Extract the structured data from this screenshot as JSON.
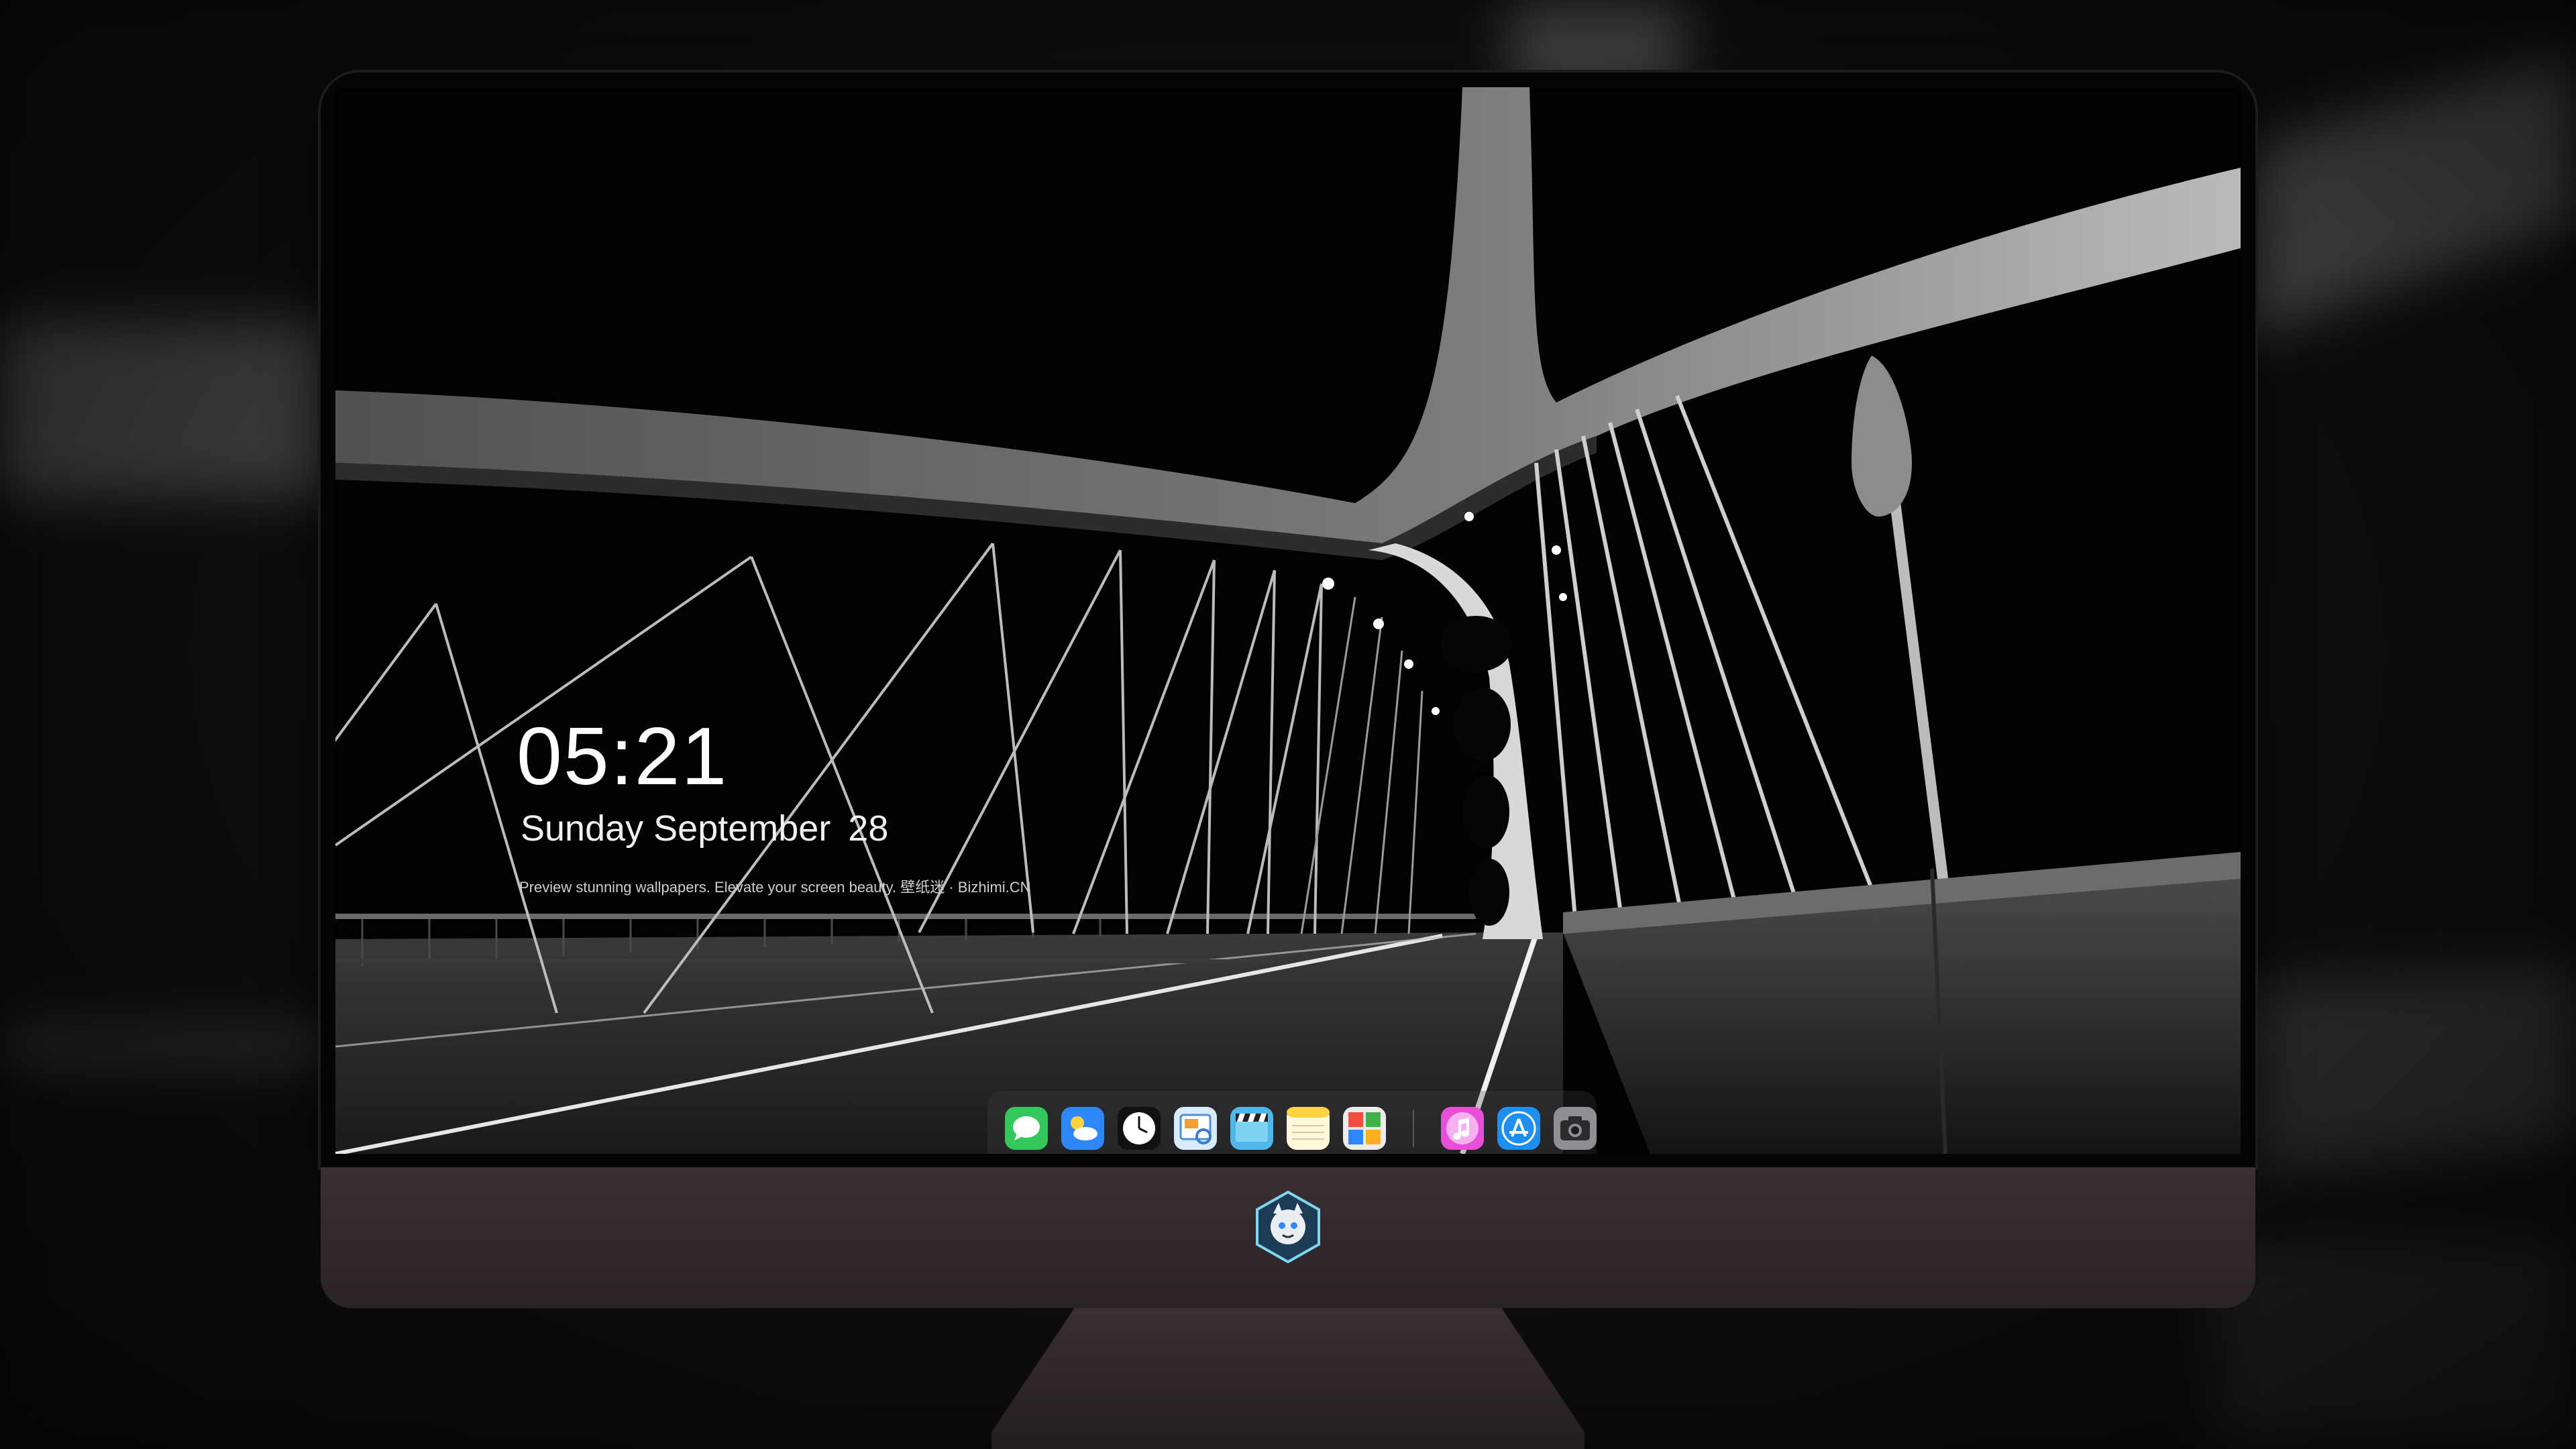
{
  "lock_screen": {
    "time": "05:21",
    "day_month": "Sunday September",
    "day_number": "28",
    "tagline": "Preview stunning wallpapers. Elevate your screen beauty. 壁纸迷 · Bizhimi.CN"
  },
  "dock": {
    "apps": [
      {
        "icon": "messages-icon"
      },
      {
        "icon": "weather-icon"
      },
      {
        "icon": "clock-icon"
      },
      {
        "icon": "preview-icon"
      },
      {
        "icon": "clips-icon"
      },
      {
        "icon": "notes-icon"
      },
      {
        "icon": "photo-booth-icon"
      }
    ],
    "extra_apps": [
      {
        "icon": "music-icon"
      },
      {
        "icon": "app-store-icon"
      },
      {
        "icon": "camera-icon"
      }
    ]
  },
  "monitor": {
    "chin_logo": "mascot-logo-icon",
    "body_color": "#332a2e"
  }
}
